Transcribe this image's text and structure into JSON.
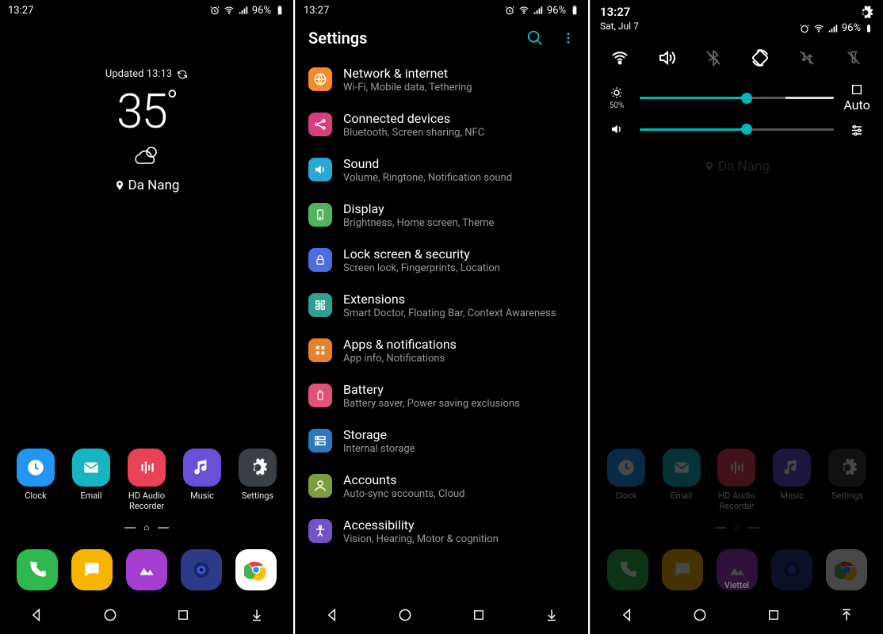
{
  "status": {
    "time": "13:27",
    "battery": "96%"
  },
  "panel1": {
    "updated": "Updated 13:13",
    "temperature": "35",
    "degree": "°",
    "location": "Da Nang",
    "apps": [
      {
        "label": "Clock"
      },
      {
        "label": "Email"
      },
      {
        "label": "HD Audio Recorder"
      },
      {
        "label": "Music"
      },
      {
        "label": "Settings"
      }
    ]
  },
  "panel2": {
    "title": "Settings",
    "items": [
      {
        "title": "Network & internet",
        "sub": "Wi-Fi, Mobile data, Tethering",
        "bg": "bg-orange",
        "icon": "globe"
      },
      {
        "title": "Connected devices",
        "sub": "Bluetooth, Screen sharing, NFC",
        "bg": "bg-magenta",
        "icon": "share"
      },
      {
        "title": "Sound",
        "sub": "Volume, Ringtone, Notification sound",
        "bg": "bg-cyan",
        "icon": "speaker"
      },
      {
        "title": "Display",
        "sub": "Brightness, Home screen, Theme",
        "bg": "bg-green",
        "icon": "phone"
      },
      {
        "title": "Lock screen & security",
        "sub": "Screen lock, Fingerprints, Location",
        "bg": "bg-blue",
        "icon": "lock"
      },
      {
        "title": "Extensions",
        "sub": "Smart Doctor, Floating Bar, Context Awareness",
        "bg": "bg-teal",
        "icon": "puzzle"
      },
      {
        "title": "Apps & notifications",
        "sub": "App info, Notifications",
        "bg": "bg-orange2",
        "icon": "grid"
      },
      {
        "title": "Battery",
        "sub": "Battery saver, Power saving exclusions",
        "bg": "bg-pink",
        "icon": "battery"
      },
      {
        "title": "Storage",
        "sub": "Internal storage",
        "bg": "bg-blue2",
        "icon": "storage"
      },
      {
        "title": "Accounts",
        "sub": "Auto-sync accounts, Cloud",
        "bg": "bg-olive",
        "icon": "person"
      },
      {
        "title": "Accessibility",
        "sub": "Vision, Hearing, Motor & cognition",
        "bg": "bg-purple",
        "icon": "accessibility"
      }
    ]
  },
  "panel3": {
    "time": "13:27",
    "date": "Sat, Jul 7",
    "battery": "96%",
    "brightness": {
      "value": 55,
      "label": "50%",
      "auto": "Auto"
    },
    "volume": {
      "value": 55
    },
    "location": "Da Nang",
    "carrier": "Viettel",
    "apps": [
      {
        "label": "Clock"
      },
      {
        "label": "Email"
      },
      {
        "label": "HD Audio Recorder"
      },
      {
        "label": "Music"
      },
      {
        "label": "Settings"
      }
    ]
  }
}
